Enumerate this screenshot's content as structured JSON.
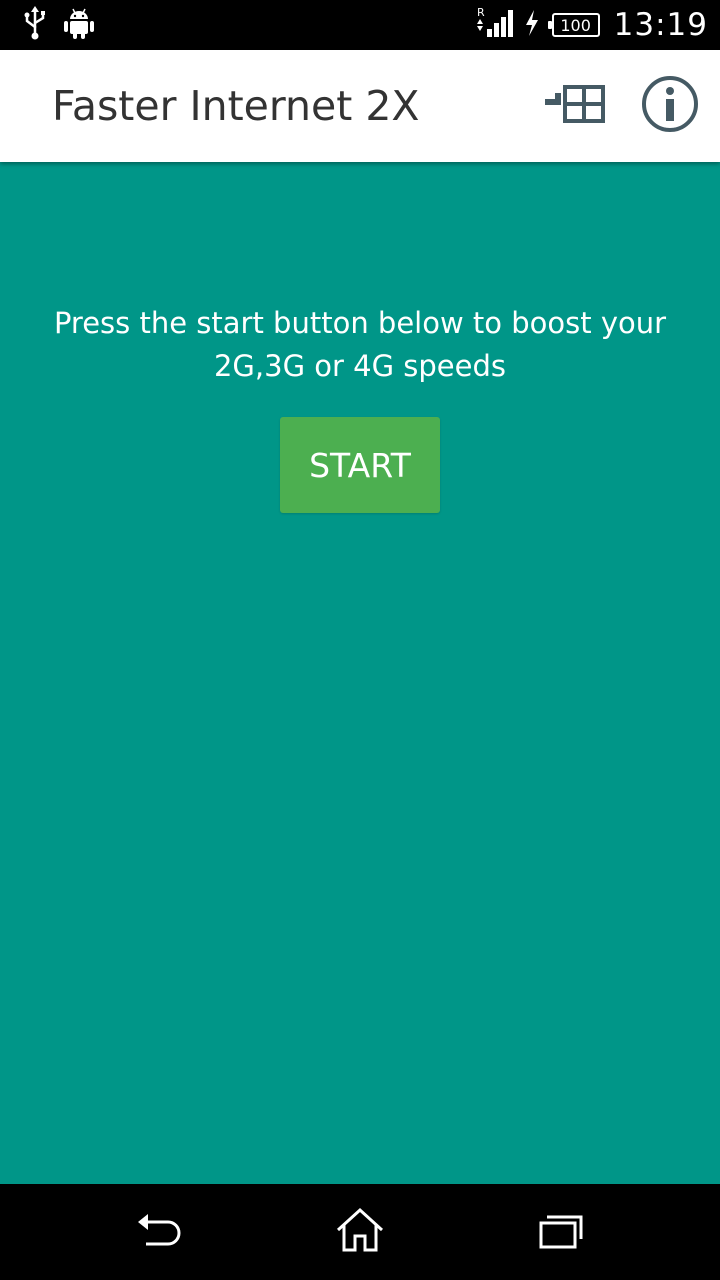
{
  "status_bar": {
    "time": "13:19",
    "battery_level": "100",
    "roaming_indicator": "R",
    "icons": [
      "usb-icon",
      "android-debug-icon",
      "signal-icon",
      "charging-icon",
      "battery-icon"
    ]
  },
  "app_bar": {
    "title": "Faster Internet 2X",
    "actions": [
      {
        "name": "apps-icon"
      },
      {
        "name": "info-icon"
      }
    ]
  },
  "main": {
    "prompt": "Press the start button below to boost your 2G,3G or 4G speeds",
    "start_label": "START"
  },
  "nav_bar": {
    "buttons": [
      "back-icon",
      "home-icon",
      "recent-apps-icon"
    ]
  },
  "colors": {
    "background": "#009688",
    "button": "#4caf50",
    "app_bar": "#ffffff",
    "icon": "#455a64"
  }
}
